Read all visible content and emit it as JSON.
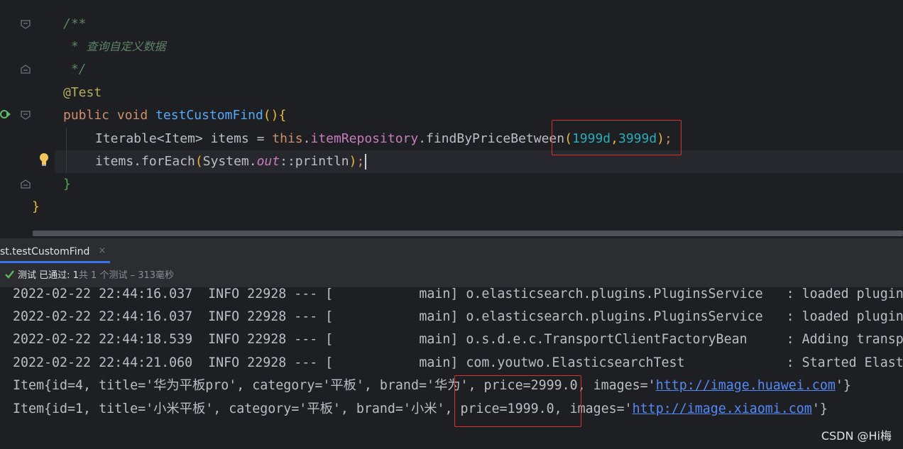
{
  "editor": {
    "lines": {
      "l1": "/**",
      "l2_prefix": " * ",
      "l2_text": "查询自定义数据",
      "l3": " */",
      "l4": "@Test",
      "l5_kw1": "public",
      "l5_kw2": "void",
      "l5_fn": "testCustomFind",
      "l5_parens": "()",
      "l5_brace": "{",
      "l6_type": "Iterable",
      "l6_generic": "<Item>",
      "l6_var": " items = ",
      "l6_this": "this",
      "l6_dot1": ".",
      "l6_field": "itemRepository",
      "l6_call": ".findByPriceBetween",
      "l6_open": "(",
      "l6_num1": "1999d",
      "l6_comma": ",",
      "l6_num2": "3999d",
      "l6_close": ")",
      "l6_semi": ";",
      "l7_a": "items.forEach",
      "l7_open": "(",
      "l7_sys": "System.",
      "l7_out": "out",
      "l7_ref": "::println",
      "l7_close": ")",
      "l7_semi": ";",
      "l8": "}",
      "l9": "}"
    }
  },
  "run_tab": {
    "label": "st.testCustomFind",
    "close": "×"
  },
  "status": {
    "prefix": "测试 已通过: 1",
    "suffix": "共 1 个测试 – 313毫秒"
  },
  "console": {
    "logs": [
      "2022-02-22 22:44:16.037  INFO 22928 --- [           main] o.elasticsearch.plugins.PluginsService   : loaded plugin",
      "2022-02-22 22:44:16.037  INFO 22928 --- [           main] o.elasticsearch.plugins.PluginsService   : loaded plugin",
      "2022-02-22 22:44:18.539  INFO 22928 --- [           main] o.s.d.e.c.TransportClientFactoryBean     : Adding transp",
      "2022-02-22 22:44:21.060  INFO 22928 --- [           main] com.youtwo.ElasticsearchTest             : Started Elast"
    ],
    "item1_pre": "Item{id=4, title='华为平板pro', category='平板', brand='华为', price=2999.0, images='",
    "item1_link": "http://image.huawei.com",
    "item1_post": "'}",
    "item2_pre": "Item{id=1, title='小米平板', category='平板', brand='小米', price=1999.0, images='",
    "item2_link": "http://image.xiaomi.com",
    "item2_post": "'}"
  },
  "watermark": "CSDN @Hi梅",
  "colors": {
    "keyword": "#cf8e6d",
    "function": "#56a8f5",
    "number": "#2aacb8",
    "field": "#c77dbb",
    "annotation": "#b3ae60",
    "comment": "#5f826b",
    "highlight_box": "#e0302d",
    "link": "#548af7"
  }
}
